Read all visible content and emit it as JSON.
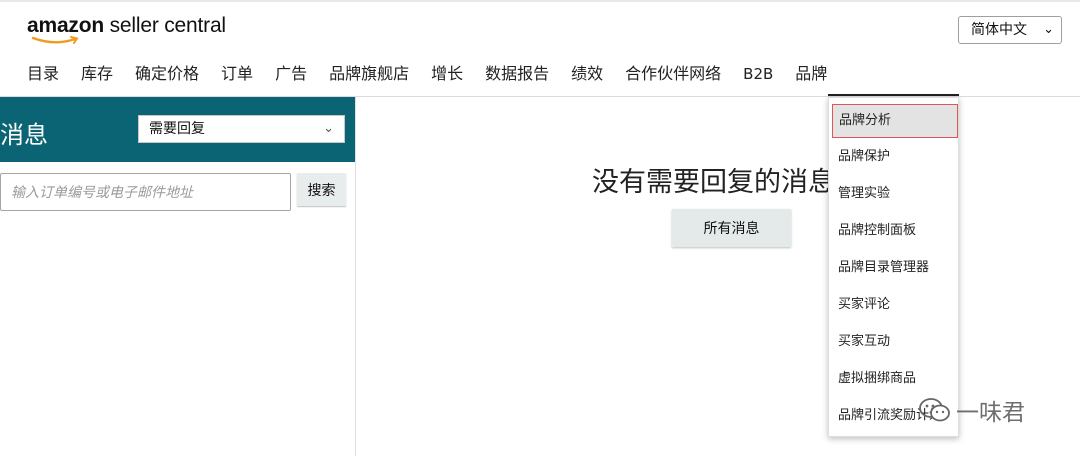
{
  "header": {
    "logo_amazon": "amazon",
    "logo_rest": " seller central",
    "language": "简体中文"
  },
  "nav": {
    "items": [
      "目录",
      "库存",
      "确定价格",
      "订单",
      "广告",
      "品牌旗舰店",
      "增长",
      "数据报告",
      "绩效",
      "合作伙伴网络",
      "B2B",
      "品牌"
    ]
  },
  "messages": {
    "title": "消息",
    "filter_value": "需要回复",
    "search_placeholder": "输入订单编号或电子邮件地址",
    "search_button": "搜索",
    "empty_text": "没有需要回复的消息",
    "all_button": "所有消息"
  },
  "brand_menu": {
    "items": [
      "品牌分析",
      "品牌保护",
      "管理实验",
      "品牌控制面板",
      "品牌目录管理器",
      "买家评论",
      "买家互动",
      "虚拟捆绑商品",
      "品牌引流奖励计划"
    ]
  },
  "watermark": {
    "text": "一味君"
  },
  "colors": {
    "teal_header": "#0b6473",
    "highlight_border": "#e05555"
  }
}
